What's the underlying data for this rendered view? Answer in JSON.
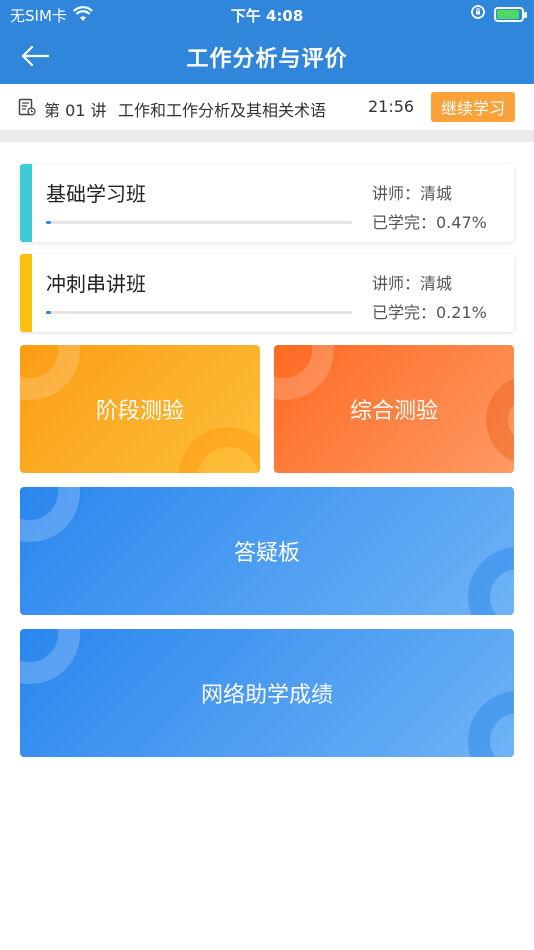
{
  "status_bar": {
    "carrier": "无SIM卡",
    "time": "下午 4:08"
  },
  "nav": {
    "title": "工作分析与评价"
  },
  "lesson": {
    "number": "第 01 讲",
    "title": "工作和工作分析及其相关术语",
    "duration": "21:56",
    "continue_label": "继续学习"
  },
  "classes": [
    {
      "name": "基础学习班",
      "teacher": "讲师：清城",
      "learned": "已学完：0.47%",
      "progress": 0.0047,
      "accent": "#3ecbd6"
    },
    {
      "name": "冲刺串讲班",
      "teacher": "讲师：清城",
      "learned": "已学完：0.21%",
      "progress": 0.0021,
      "accent": "#f8c10c"
    }
  ],
  "tiles": {
    "stage_test": "阶段测验",
    "comprehensive_test": "综合测验",
    "qa_board": "答疑板",
    "online_scores": "网络助学成绩"
  },
  "colors": {
    "primary": "#2f86db",
    "orange": "#f9a23a"
  }
}
